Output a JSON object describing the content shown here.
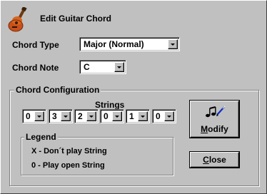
{
  "dialog": {
    "title": "Edit Guitar Chord",
    "icon": "guitar-icon"
  },
  "chord_type": {
    "label": "Chord Type",
    "value": "Major (Normal)"
  },
  "chord_note": {
    "label": "Chord Note",
    "value": "C"
  },
  "configuration": {
    "title": "Chord Configuration",
    "strings_label": "Strings",
    "strings": [
      {
        "value": "0"
      },
      {
        "value": "3"
      },
      {
        "value": "2"
      },
      {
        "value": "0"
      },
      {
        "value": "1"
      },
      {
        "value": "0"
      }
    ]
  },
  "legend": {
    "title": "Legend",
    "lines": [
      "X - Don´t play String",
      "0 - Play open String"
    ]
  },
  "buttons": {
    "modify_accel": "M",
    "modify_rest": "odify",
    "modify_icon": "music-notes-pencil-icon",
    "close_accel": "C",
    "close_rest": "lose"
  }
}
